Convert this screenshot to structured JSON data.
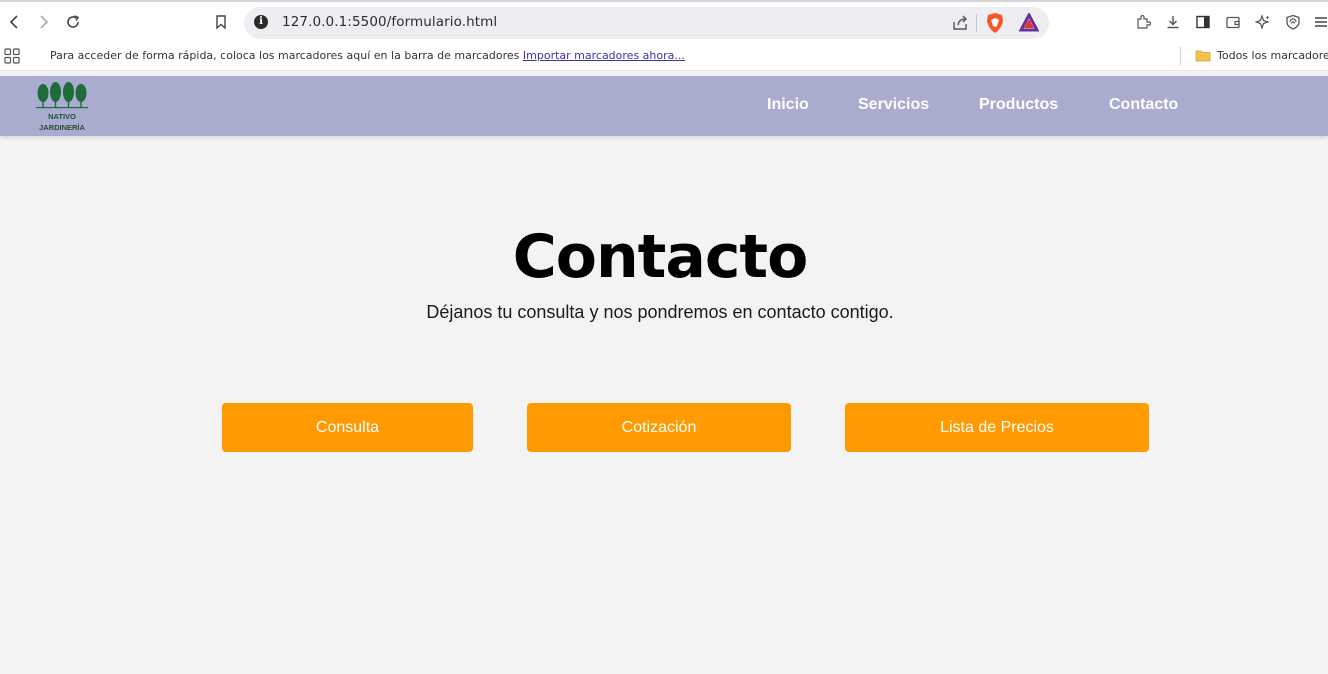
{
  "browser": {
    "url": "127.0.0.1:5500/formulario.html",
    "bookmarks_prompt": "Para acceder de forma rápida, coloca los marcadores aquí en la barra de marcadores",
    "import_link": "Importar marcadores ahora...",
    "all_bookmarks": "Todos los marcadores",
    "icons": [
      "back-icon",
      "forward-icon",
      "reload-icon",
      "bookmark-icon",
      "info-icon",
      "share-icon",
      "brave-shields-icon",
      "brave-rewards-icon",
      "extensions-icon",
      "download-icon",
      "sidebar-icon",
      "wallet-icon",
      "leo-icon",
      "vpn-icon",
      "menu-icon",
      "apps-icon",
      "folder-icon"
    ]
  },
  "site": {
    "logo_line1": "NATIVO",
    "logo_line2": "JARDINERÍA",
    "nav": [
      "Inicio",
      "Servicios",
      "Productos",
      "Contacto"
    ],
    "colors": {
      "header_bg": "#a9acce",
      "button_bg": "#ff9a00",
      "page_bg": "#f3f3f3",
      "logo_green": "#1f5130"
    }
  },
  "main": {
    "title": "Contacto",
    "subtitle": "Déjanos tu consulta y nos pondremos en contacto contigo.",
    "buttons": [
      "Consulta",
      "Cotización",
      "Lista de Precios"
    ]
  }
}
